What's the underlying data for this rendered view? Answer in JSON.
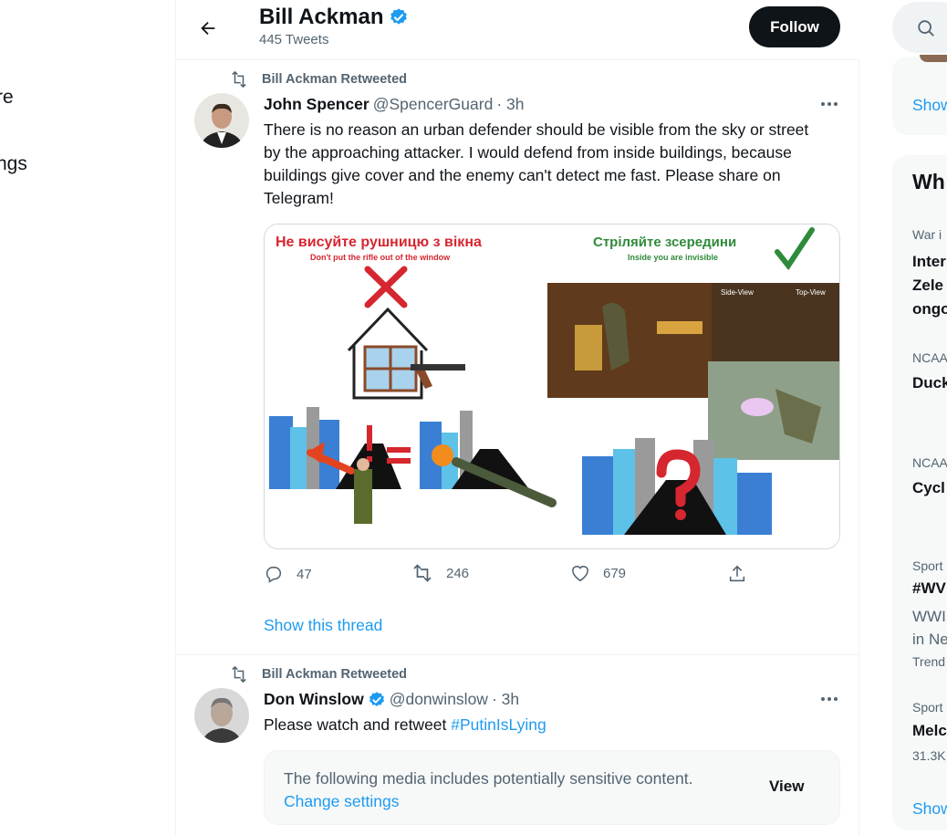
{
  "left_nav": {
    "items": [
      "re",
      "ngs"
    ]
  },
  "header": {
    "name": "Bill Ackman",
    "tweet_count": "445 Tweets",
    "follow_label": "Follow"
  },
  "tweets": [
    {
      "retweeted_by": "Bill Ackman Retweeted",
      "name": "John Spencer",
      "handle": "@SpencerGuard",
      "time": "· 3h",
      "text": "There is no reason an urban defender should be visible from the sky or street by the approaching attacker. I would defend from inside buildings, because buildings give cover and the enemy can't detect me fast. Please share on Telegram!",
      "media": {
        "left_title": "Не висуйте рушницю з вікна",
        "left_subtitle": "Don't put the rifle out of the window",
        "right_title": "Стріляйте зсередини",
        "right_subtitle": "Inside you are invisible",
        "side_view": "Side-View",
        "top_view": "Top-View"
      },
      "replies": "47",
      "retweets": "246",
      "likes": "679",
      "show_thread": "Show this thread"
    },
    {
      "retweeted_by": "Bill Ackman Retweeted",
      "name": "Don Winslow",
      "handle": "@donwinslow",
      "time": "· 3h",
      "text_prefix": "Please watch and retweet ",
      "hashtag": "#PutinIsLying",
      "sensitive_text": "The following media includes potentially sensitive content.",
      "change_settings": "Change settings",
      "view_label": "View"
    }
  ],
  "sidebar": {
    "show_label_1": "Show",
    "trends_title": "Wh",
    "trends": [
      {
        "context": "War i",
        "lines": [
          "Inter",
          "Zele",
          "ongo"
        ]
      },
      {
        "context": "NCAA",
        "lines": [
          "Duck"
        ]
      },
      {
        "context": "NCAA",
        "lines": [
          "Cycl"
        ]
      },
      {
        "context": "Sport",
        "lines": [
          "#WV"
        ],
        "sub": [
          "WWI",
          "in Ne"
        ],
        "extra": "Trend"
      },
      {
        "context": "Sport",
        "lines": [
          "Melc"
        ],
        "extra": "31.3K"
      }
    ],
    "show_label_2": "Show"
  },
  "colors": {
    "accent": "#1d9bf0",
    "verified": "#1d9bf0",
    "text_secondary": "#536471"
  }
}
